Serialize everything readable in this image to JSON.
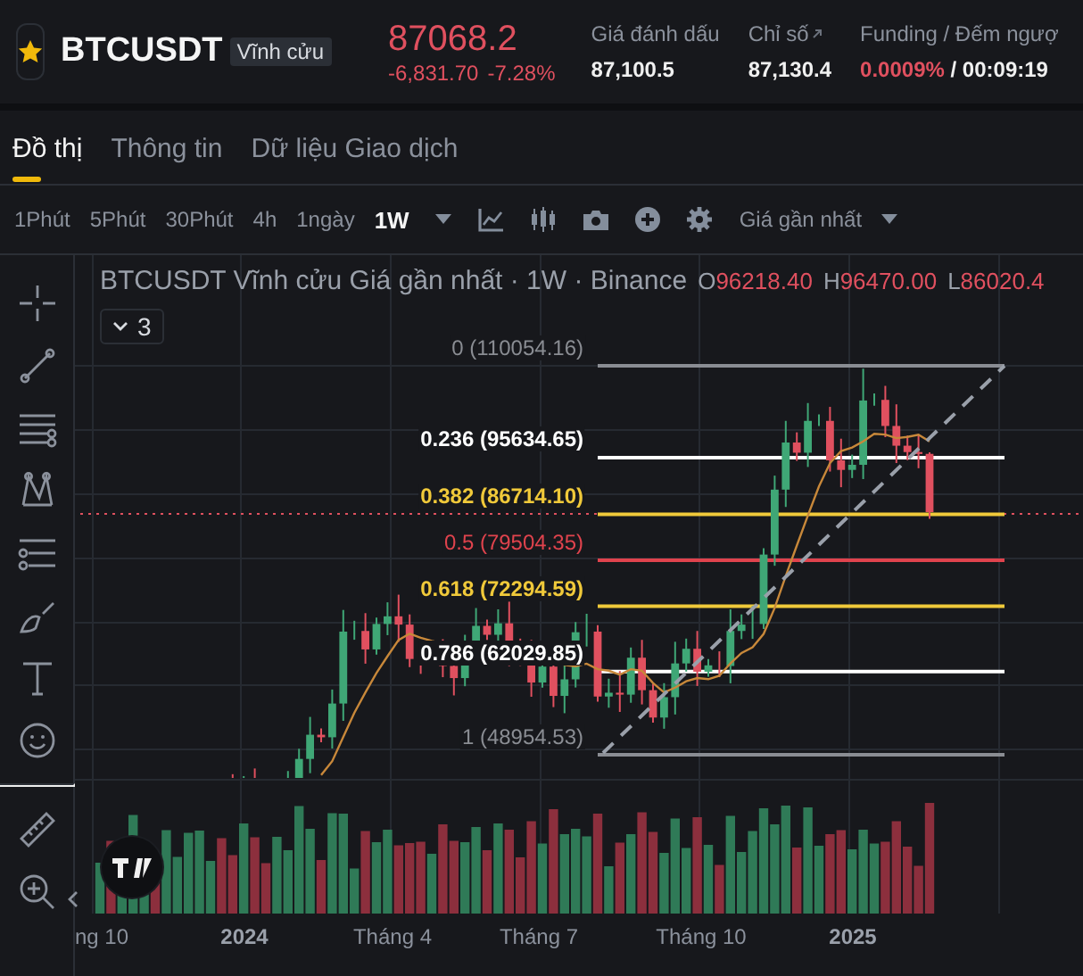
{
  "header": {
    "symbol": "BTCUSDT",
    "contract": "Vĩnh cửu",
    "price": "87068.2",
    "change": "-6,831.70",
    "change_pct": "-7.28%",
    "stats": [
      {
        "label": "Giá đánh dấu",
        "value": "87,100.5",
        "kind": "plain"
      },
      {
        "label": "Chỉ số",
        "value": "87,130.4",
        "kind": "index"
      }
    ],
    "funding": {
      "label": "Funding / Đếm ngượ",
      "rate": "0.0009%",
      "countdown": "/ 00:09:19"
    }
  },
  "tabs": [
    {
      "label": "Đồ thị",
      "selected": true
    },
    {
      "label": "Thông tin",
      "selected": false
    },
    {
      "label": "Dữ liệu Giao dịch",
      "selected": false
    }
  ],
  "toolbar": {
    "intervals": [
      {
        "label": "1Phút",
        "selected": false
      },
      {
        "label": "5Phút",
        "selected": false
      },
      {
        "label": "30Phút",
        "selected": false
      },
      {
        "label": "4h",
        "selected": false
      },
      {
        "label": "1ngày",
        "selected": false
      },
      {
        "label": "1W",
        "selected": true
      }
    ],
    "price_type": "Giá gần nhất"
  },
  "chart": {
    "legend": {
      "title": "BTCUSDT Vĩnh cửu Giá gần nhất · 1W · Binance",
      "ohlc": [
        {
          "key": "O",
          "value": "96218.40"
        },
        {
          "key": "H",
          "value": "96470.00"
        },
        {
          "key": "L",
          "value": "86020.4"
        }
      ]
    },
    "indicator_count": "3",
    "fib_levels": [
      {
        "label": "0 (110054.16)",
        "color": "#8a8d93"
      },
      {
        "label": "0.236 (95634.65)",
        "color": "#ffffff"
      },
      {
        "label": "0.382 (86714.10)",
        "color": "#f0c93a"
      },
      {
        "label": "0.5 (79504.35)",
        "color": "#e0434d"
      },
      {
        "label": "0.618 (72294.59)",
        "color": "#f0c93a"
      },
      {
        "label": "0.786 (62029.85)",
        "color": "#ffffff"
      },
      {
        "label": "1 (48954.53)",
        "color": "#8a8d93"
      }
    ],
    "x_axis": [
      {
        "label": "ng 10",
        "kind": "month"
      },
      {
        "label": "2024",
        "kind": "year"
      },
      {
        "label": "Tháng 4",
        "kind": "month"
      },
      {
        "label": "Tháng 7",
        "kind": "month"
      },
      {
        "label": "Tháng 10",
        "kind": "month"
      },
      {
        "label": "2025",
        "kind": "year"
      }
    ]
  }
}
